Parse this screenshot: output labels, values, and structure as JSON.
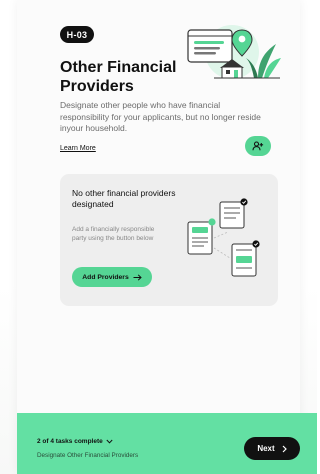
{
  "header": {
    "badge": "H-03",
    "title": "Other Financial Providers",
    "description": "Designate other people who have financial responsibility for your applicants, but no longer reside inyour household.",
    "learn_more": "Learn More"
  },
  "empty_state": {
    "title": "No other financial providers designated",
    "subtitle": "Add a financially responsible party using the button below",
    "button_label": "Add Providers"
  },
  "footer": {
    "progress": "2 of 4 tasks complete",
    "current_task": "Designate Other Financial Providers",
    "next_label": "Next"
  },
  "icons": {
    "add_person": "add-person-icon",
    "arrow_right": "arrow-right-icon",
    "chevron_down": "chevron-down-icon",
    "chevron_right": "chevron-right-icon"
  },
  "colors": {
    "accent": "#55d594",
    "footer_bg": "#63e0a3",
    "card_bg": "#eeeeee",
    "dark": "#111111"
  }
}
